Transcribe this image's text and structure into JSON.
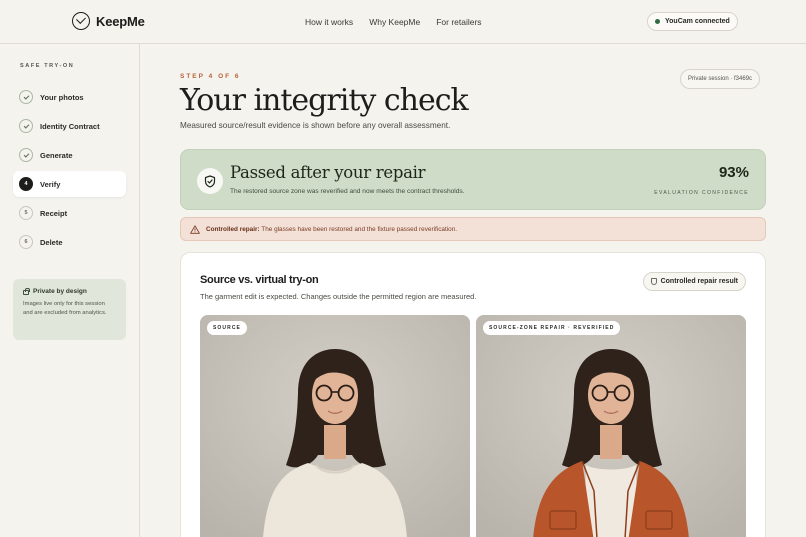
{
  "header": {
    "logo_text": "KeepMe",
    "nav": [
      "How it works",
      "Why KeepMe",
      "For retailers"
    ],
    "connection_label": "YouCam connected"
  },
  "sidebar": {
    "heading": "SAFE TRY-ON",
    "steps": [
      {
        "label": "Your photos",
        "state": "done",
        "marker": ""
      },
      {
        "label": "Identity Contract",
        "state": "done",
        "marker": ""
      },
      {
        "label": "Generate",
        "state": "done",
        "marker": ""
      },
      {
        "label": "Verify",
        "state": "current",
        "marker": "4"
      },
      {
        "label": "Receipt",
        "state": "pending",
        "marker": "5"
      },
      {
        "label": "Delete",
        "state": "pending",
        "marker": "6"
      }
    ],
    "privacy": {
      "title": "Private by design",
      "text": "Images live only for this session and are excluded from analytics."
    }
  },
  "main": {
    "eyebrow": "STEP 4 OF 6",
    "title": "Your integrity check",
    "subtitle": "Measured source/result evidence is shown before any overall assessment.",
    "session_label": "Private session · f3469c",
    "result": {
      "title": "Passed after your repair",
      "description": "The restored source zone was reverified and now meets the contract thresholds.",
      "confidence_value": "93%",
      "confidence_label": "EVALUATION CONFIDENCE",
      "color": "#cfdcc8"
    },
    "alert": {
      "strong": "Controlled repair:",
      "text": "The glasses have been restored and the fixture passed reverification.",
      "color": "#f3e1d8"
    },
    "comparison": {
      "title": "Source vs. virtual try-on",
      "subtitle": "The garment edit is expected. Changes outside the permitted region are measured.",
      "badge": "Controlled repair result",
      "left_label": "SOURCE",
      "right_label": "SOURCE-ZONE REPAIR · REVERIFIED"
    }
  },
  "colors": {
    "accent": "#b8623a",
    "success_bg": "#cfdcc8",
    "jacket": "#b9552a"
  }
}
